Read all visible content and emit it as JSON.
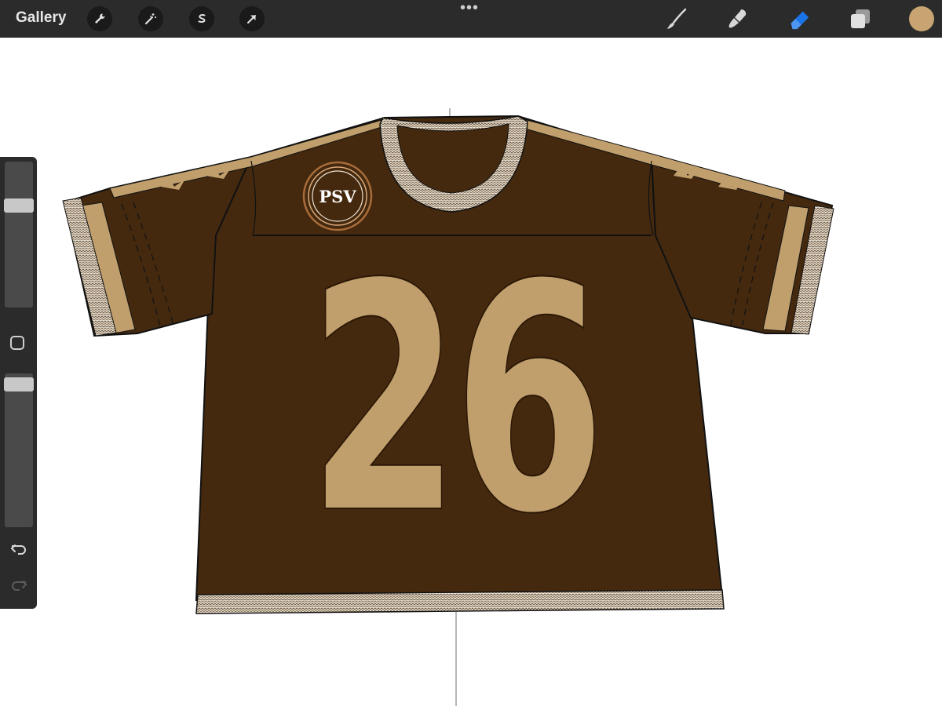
{
  "topbar": {
    "gallery_label": "Gallery",
    "left_tools": [
      "wrench-icon",
      "magic-wand-icon",
      "selection-icon",
      "transform-arrow-icon"
    ],
    "right_tools": [
      "brush-icon",
      "smudge-icon",
      "eraser-icon",
      "layers-icon"
    ],
    "active_tool": "eraser",
    "active_tool_color": "#1a73e8",
    "current_color": "#c8a472"
  },
  "sidebar": {
    "brush_size_level": 0.7,
    "opacity_level": 0.93
  },
  "artwork": {
    "logo_text": "PSV",
    "jersey_number": "26",
    "jersey_color": "#44290f",
    "accent_color": "#c09f6d"
  }
}
